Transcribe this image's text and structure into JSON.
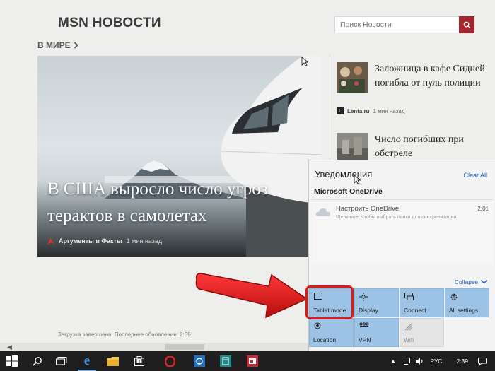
{
  "app": {
    "title": "MSN НОВОСТИ",
    "search_placeholder": "Поиск Новости",
    "section": "В МИРЕ"
  },
  "hero": {
    "headline": "В США выросло число угроз терактов в самолетах",
    "source": "Аргументы и Факты",
    "time": "1 мин назад"
  },
  "side_articles": [
    {
      "title": "Заложница в кафе Сидней погибла от пуль полиции",
      "source_mark": "L",
      "source": "Lenta.ru",
      "time": "1 мин назад"
    },
    {
      "title": "Число погибших при обстреле"
    }
  ],
  "status": "Загрузка завершена. Последнее обновление: 2:39.",
  "action_center": {
    "title": "Уведомления",
    "clear_all": "Clear All",
    "app_group": "Microsoft OneDrive",
    "notification": {
      "title": "Настроить OneDrive",
      "time": "2:01",
      "body": "Щелкните, чтобы выбрать папки для синхронизации"
    },
    "collapse": "Collapse",
    "tiles": [
      {
        "label": "Tablet mode",
        "icon": "tablet-icon",
        "active": true
      },
      {
        "label": "Display",
        "icon": "display-icon",
        "active": true
      },
      {
        "label": "Connect",
        "icon": "connect-icon",
        "active": true
      },
      {
        "label": "All settings",
        "icon": "gear-icon",
        "active": true
      },
      {
        "label": "Location",
        "icon": "location-icon",
        "active": true
      },
      {
        "label": "VPN",
        "icon": "vpn-icon",
        "active": true
      },
      {
        "label": "Wifi",
        "icon": "wifi-icon",
        "active": false
      }
    ]
  },
  "taskbar": {
    "language": "РУС",
    "clock": "2:39"
  },
  "colors": {
    "accent_red": "#a4262c",
    "tile_active": "#9cc2e5",
    "annotation_red": "#e01818"
  }
}
